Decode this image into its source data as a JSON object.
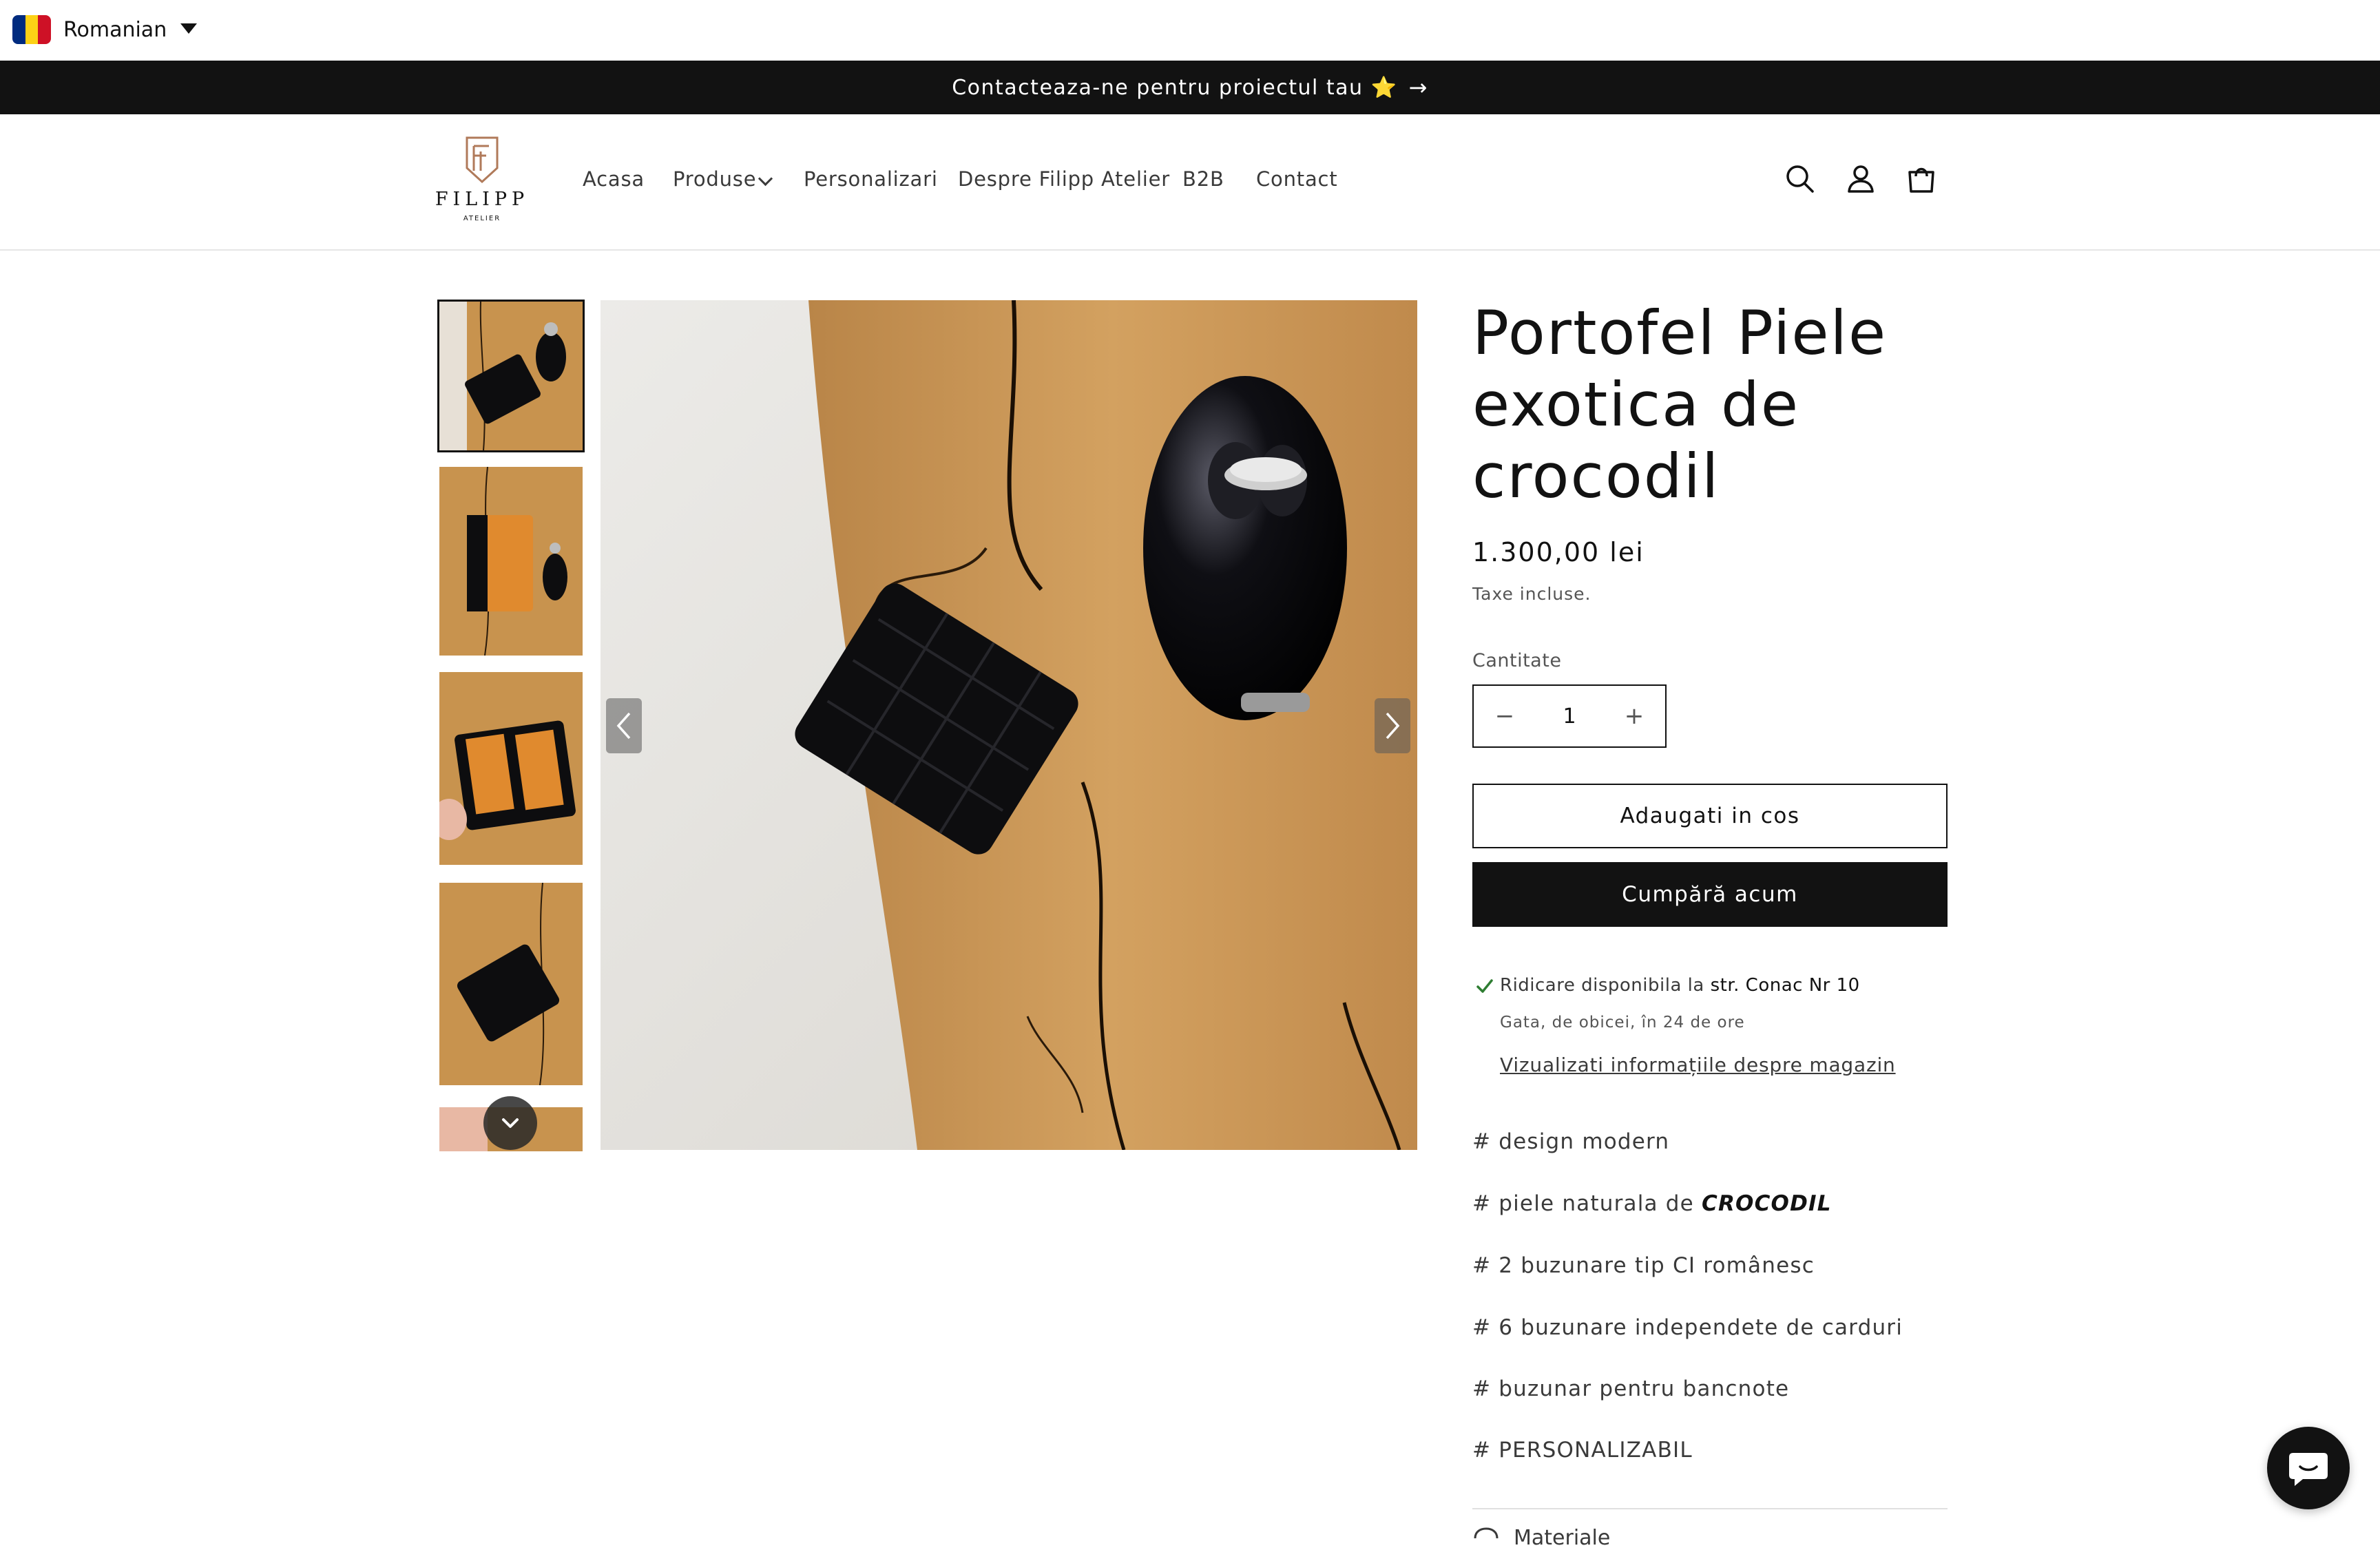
{
  "language": {
    "label": "Romanian",
    "flag_colors": [
      "#002B7F",
      "#FCD116",
      "#CE1126"
    ]
  },
  "announcement": {
    "text": "Contacteaza-ne pentru proiectul tau ⭐",
    "arrow": "→"
  },
  "brand": {
    "name": "FILIPP",
    "sub": "ATELIER",
    "monogram": "F"
  },
  "nav": {
    "home": "Acasa",
    "products": "Produse",
    "personalization": "Personalizari",
    "about": "Despre Filipp Atelier",
    "b2b": "B2B",
    "contact": "Contact"
  },
  "header_icons": [
    "search-icon",
    "account-icon",
    "cart-icon"
  ],
  "product": {
    "title": "Portofel Piele exotica de crocodil",
    "price": "1.300,00 lei",
    "tax_note": "Taxe incluse.",
    "quantity_label": "Cantitate",
    "quantity_value": "1",
    "qty_minus": "−",
    "qty_plus": "+",
    "add_to_cart": "Adaugati in cos",
    "buy_now": "Cumpără acum"
  },
  "pickup": {
    "text": "Ridicare disponibila la",
    "location": "str. Conac Nr 10",
    "time": "Gata, de obicei, în 24 de ore",
    "link": "Vizualizati informațiile despre magazin"
  },
  "features": {
    "f1": "# design modern",
    "f2_prefix": "# piele naturala de",
    "f2_emph": "CROCODIL",
    "f3": "# 2 buzunare tip CI românesc",
    "f4": "# 6 buzunare independete de carduri",
    "f5": "# buzunar pentru bancnote",
    "f6": "# PERSONALIZABIL"
  },
  "materials": {
    "label": "Materiale"
  },
  "colors": {
    "dark": "#121212",
    "wood": "#C8934E",
    "leather": "#0d0d0f",
    "leather_interior": "#E08A2E",
    "pickup_check": "#2E7D32"
  }
}
